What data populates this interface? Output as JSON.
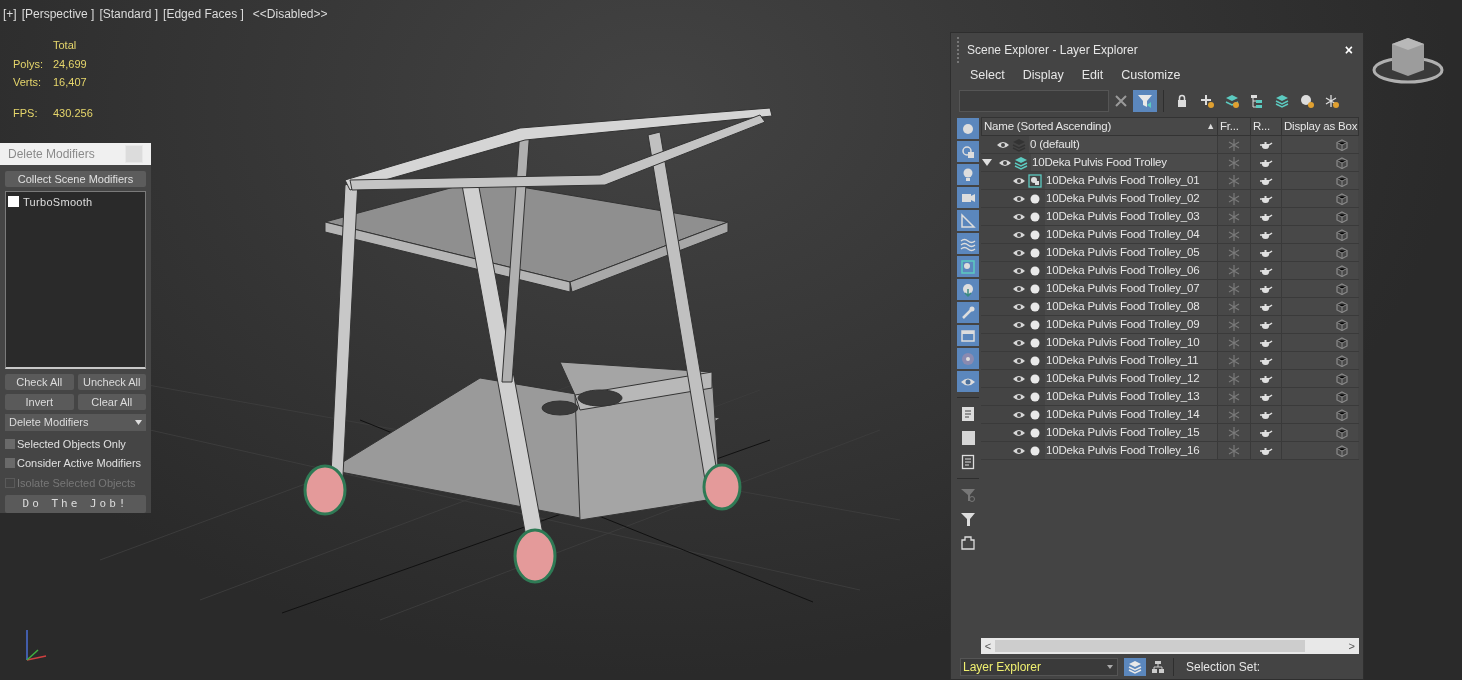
{
  "viewport": {
    "labels": [
      "[+]",
      "[Perspective ]",
      "[Standard ]",
      "[Edged Faces ]",
      "<<Disabled>>"
    ],
    "stats": {
      "header": "Total",
      "rows": [
        {
          "label": "Polys:",
          "value": "24,699"
        },
        {
          "label": "Verts:",
          "value": "16,407"
        }
      ],
      "fps_label": "FPS:",
      "fps_value": "430.256"
    }
  },
  "delete_modifiers": {
    "title": "Delete Modifiers",
    "collect_button": "Collect Scene Modifiers",
    "modifiers": [
      {
        "label": "TurboSmooth",
        "checked": false
      }
    ],
    "buttons": [
      "Check All",
      "Uncheck All",
      "Invert",
      "Clear All"
    ],
    "mode": "Delete Modifiers",
    "options": [
      {
        "label": "Selected Objects Only",
        "checked": false,
        "disabled": false
      },
      {
        "label": "Consider Active Modifiers",
        "checked": false,
        "disabled": false
      },
      {
        "label": "Isolate Selected Objects",
        "checked": false,
        "disabled": true
      }
    ],
    "run_button": "Do The Job!"
  },
  "scene_explorer": {
    "title": "Scene Explorer - Layer Explorer",
    "close": "×",
    "menu": [
      "Select",
      "Display",
      "Edit",
      "Customize"
    ],
    "filter_on": true,
    "type_filters": [
      {
        "kind": "geometry",
        "on": true
      },
      {
        "kind": "shape",
        "on": true
      },
      {
        "kind": "light",
        "on": true
      },
      {
        "kind": "camera",
        "on": true
      },
      {
        "kind": "helper",
        "on": true
      },
      {
        "kind": "spacewarp",
        "on": true
      },
      {
        "kind": "group",
        "on": true
      },
      {
        "kind": "xref",
        "on": true
      },
      {
        "kind": "bone",
        "on": true
      },
      {
        "kind": "container",
        "on": true
      },
      {
        "kind": "frozen",
        "on": true
      },
      {
        "kind": "hidden",
        "on": true
      }
    ],
    "columns": [
      "Name (Sorted Ascending)",
      "Fr...",
      "R...",
      "Display as Box"
    ],
    "sort_arrow": "▲",
    "rows": [
      {
        "kind": "layer",
        "name": "0 (default)",
        "active": false
      },
      {
        "kind": "layer",
        "name": "10Deka Pulvis Food Trolley",
        "active": true,
        "expanded": true,
        "children": [
          {
            "kind": "group",
            "name": "10Deka Pulvis Food Trolley_01"
          },
          {
            "kind": "object",
            "name": "10Deka Pulvis Food Trolley_02"
          },
          {
            "kind": "object",
            "name": "10Deka Pulvis Food Trolley_03"
          },
          {
            "kind": "object",
            "name": "10Deka Pulvis Food Trolley_04"
          },
          {
            "kind": "object",
            "name": "10Deka Pulvis Food Trolley_05"
          },
          {
            "kind": "object",
            "name": "10Deka Pulvis Food Trolley_06"
          },
          {
            "kind": "object",
            "name": "10Deka Pulvis Food Trolley_07"
          },
          {
            "kind": "object",
            "name": "10Deka Pulvis Food Trolley_08"
          },
          {
            "kind": "object",
            "name": "10Deka Pulvis Food Trolley_09"
          },
          {
            "kind": "object",
            "name": "10Deka Pulvis Food Trolley_10"
          },
          {
            "kind": "object",
            "name": "10Deka Pulvis Food Trolley_11"
          },
          {
            "kind": "object",
            "name": "10Deka Pulvis Food Trolley_12"
          },
          {
            "kind": "object",
            "name": "10Deka Pulvis Food Trolley_13"
          },
          {
            "kind": "object",
            "name": "10Deka Pulvis Food Trolley_14"
          },
          {
            "kind": "object",
            "name": "10Deka Pulvis Food Trolley_15"
          },
          {
            "kind": "object",
            "name": "10Deka Pulvis Food Trolley_16"
          }
        ]
      }
    ],
    "scroll_left": "<",
    "scroll_right": ">",
    "explorer": "Layer Explorer",
    "layer_mode_on": true,
    "selection_set_label": "Selection Set:"
  }
}
